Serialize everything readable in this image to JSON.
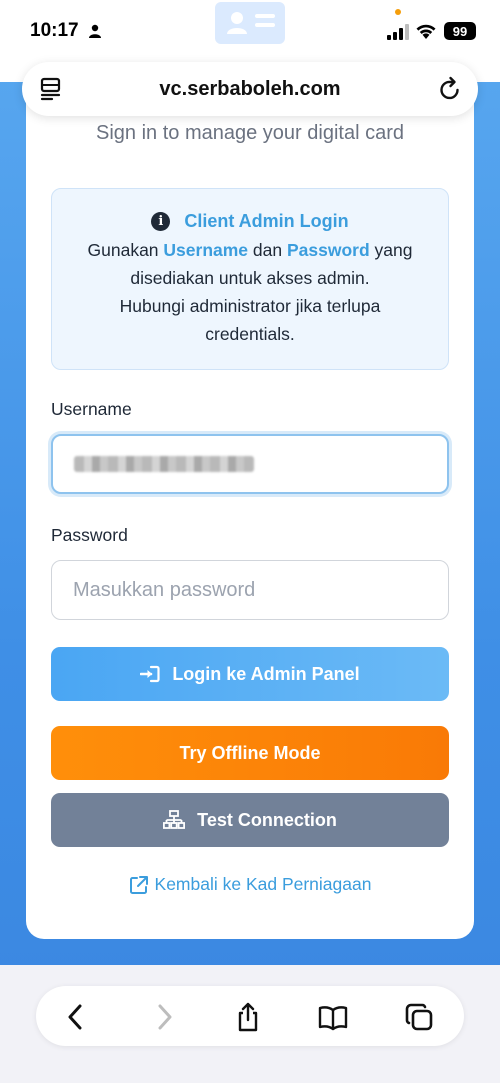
{
  "status_bar": {
    "time": "10:17",
    "battery": "99"
  },
  "browser": {
    "url": "vc.serbaboleh.com"
  },
  "page": {
    "subtitle": "Sign in to manage your digital card",
    "info": {
      "title": "Client Admin Login",
      "line1_pre": "Gunakan ",
      "line1_user": "Username",
      "line1_mid": " dan ",
      "line1_pass": "Password",
      "line1_post": " yang",
      "line2": "disediakan untuk akses admin.",
      "line3": "Hubungi administrator jika terlupa",
      "line4": "credentials."
    },
    "username_label": "Username",
    "password_label": "Password",
    "password_placeholder": "Masukkan password",
    "login_button": "Login ke Admin Panel",
    "offline_button": "Try Offline Mode",
    "test_button": "Test Connection",
    "back_link": "Kembali ke Kad Perniagaan"
  },
  "colors": {
    "accent": "#3b9ddd",
    "login": "#4aa6f3",
    "offline": "#ff8f0a",
    "test": "#728198"
  }
}
